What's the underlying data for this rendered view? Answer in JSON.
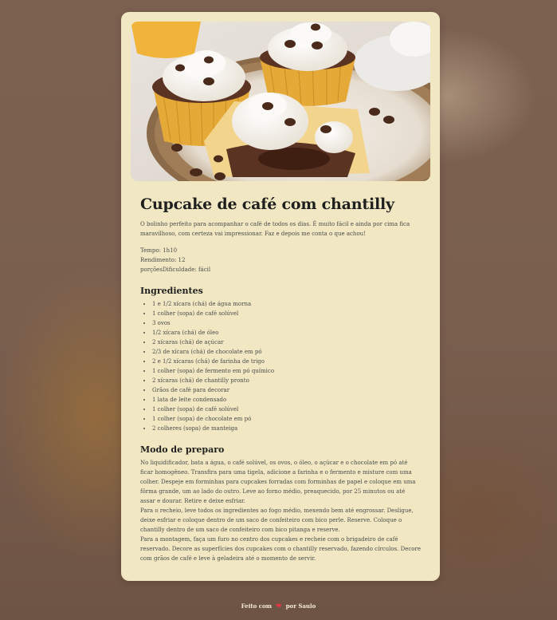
{
  "recipe": {
    "title": "Cupcake de café com chantilly",
    "intro": "O bolinho perfeito para acompanhar o café de todos os dias. É muito fácil e ainda por cima fica maravilhoso, com certeza vai impressionar. Faz e depois me conta o que achou!",
    "time": "Tempo: 1h10",
    "yield": "Rendimento: 12",
    "difficulty": "porçõesDificuldade: fácil",
    "hero_image_icon": "cupcake-photo"
  },
  "ingredients": {
    "heading": "Ingredientes",
    "items": [
      "1 e 1/2 xícara (chá) de água morna",
      "1 colher (sopa) de café solúvel",
      "3 ovos",
      "1/2 xícara (chá) de óleo",
      "2 xícaras (chá) de açúcar",
      "2/3 de xícara (chá) de chocolate em pó",
      "2 e 1/2 xícaras (chá) de farinha de trigo",
      "1 colher (sopa) de fermento em pó químico",
      "2 xícaras (chá) de chantilly pronto",
      "Grãos de café para decorar",
      "1 lata de leite condensado",
      "1 colher (sopa) de café solúvel",
      "1 colher (sopa) de chocolate em pó",
      "2 colheres (sopa) de manteiga"
    ]
  },
  "preparation": {
    "heading": "Modo de preparo",
    "paragraphs": [
      "No liquidificador, bata a água, o café solúvel, os ovos, o óleo, o açúcar e o chocolate em pó até ficar homogêneo. Transfira para uma tigela, adicione a farinha e o fermento e misture com uma colher. Despeje em forminhas para cupcakes forradas com forminhas de papel e coloque em uma fôrma grande, um ao lado do outro. Leve ao forno médio, preaquecido, por 25 minutos ou até assar e dourar. Retire e deixe esfriar.",
      "Para o recheio, leve todos os ingredientes ao fogo médio, mexendo bem até engrossar. Desligue, deixe esfriar e coloque dentro de um saco de confeiteiro com bico perle. Reserve. Coloque o chantilly dentro de um saco de confeiteiro com bico pitanga e reserve.",
      "Para a montagem, faça um furo no centro dos cupcakes e recheie com o brigadeiro de café reservado. Decore as superfícies dos cupcakes com o chantilly reservado, fazendo círculos. Decore com grãos de café e leve à geladeira até o momento de servir."
    ]
  },
  "footer": {
    "made_with": "Feito com",
    "heart_icon": "heart-icon",
    "by": "por Saulo"
  },
  "colors": {
    "card_bg": "#f1e8c3",
    "page_bg": "#7c6150",
    "heart": "#e0383e"
  }
}
